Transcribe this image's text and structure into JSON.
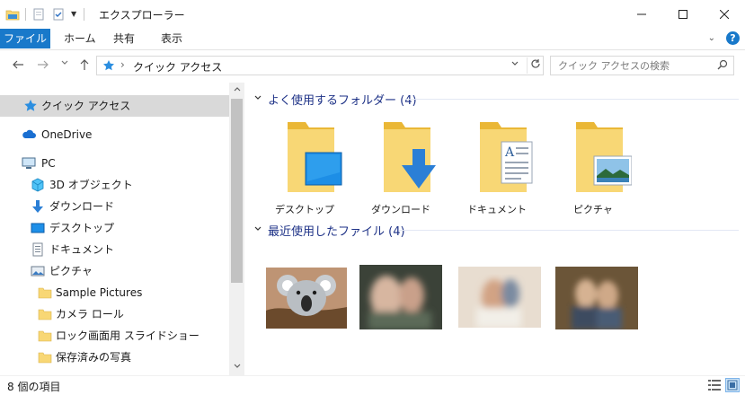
{
  "window": {
    "title": "エクスプローラー",
    "minimize": "—",
    "maximize": "☐",
    "close": "✕"
  },
  "ribbon": {
    "tabs": [
      "ファイル",
      "ホーム",
      "共有",
      "表示"
    ]
  },
  "address": {
    "crumb": "クイック アクセス",
    "separator": "›"
  },
  "search": {
    "placeholder": "クイック アクセスの検索"
  },
  "nav": {
    "items": [
      {
        "label": "クイック アクセス",
        "icon": "star-icon"
      },
      {
        "label": "OneDrive",
        "icon": "cloud-icon"
      },
      {
        "label": "PC",
        "icon": "computer-icon"
      },
      {
        "label": "3D オブジェクト",
        "icon": "cube-icon"
      },
      {
        "label": "ダウンロード",
        "icon": "download-icon"
      },
      {
        "label": "デスクトップ",
        "icon": "desktop-icon"
      },
      {
        "label": "ドキュメント",
        "icon": "document-icon"
      },
      {
        "label": "ピクチャ",
        "icon": "picture-icon"
      },
      {
        "label": "Sample Pictures",
        "icon": "folder-icon"
      },
      {
        "label": "カメラ ロール",
        "icon": "folder-icon"
      },
      {
        "label": "ロック画面用 スライドショー",
        "icon": "folder-icon"
      },
      {
        "label": "保存済みの写真",
        "icon": "folder-icon"
      }
    ]
  },
  "content": {
    "frequent_header": "よく使用するフォルダー (4)",
    "recent_header": "最近使用したファイル (4)",
    "folders": [
      {
        "label": "デスクトップ",
        "icon": "desktop-folder-icon"
      },
      {
        "label": "ダウンロード",
        "icon": "download-folder-icon"
      },
      {
        "label": "ドキュメント",
        "icon": "documents-folder-icon"
      },
      {
        "label": "ピクチャ",
        "icon": "pictures-folder-icon"
      }
    ],
    "recent_files": [
      {
        "icon": "koala-thumbnail"
      },
      {
        "icon": "blurred-photo-thumbnail"
      },
      {
        "icon": "blurred-photo-thumbnail"
      },
      {
        "icon": "blurred-photo-thumbnail"
      }
    ]
  },
  "status": {
    "count": "8 個の項目"
  },
  "colors": {
    "accent": "#1979ca",
    "group_header": "#1e3287",
    "selection": "#d9d9d9",
    "folder": "#f8d775"
  }
}
